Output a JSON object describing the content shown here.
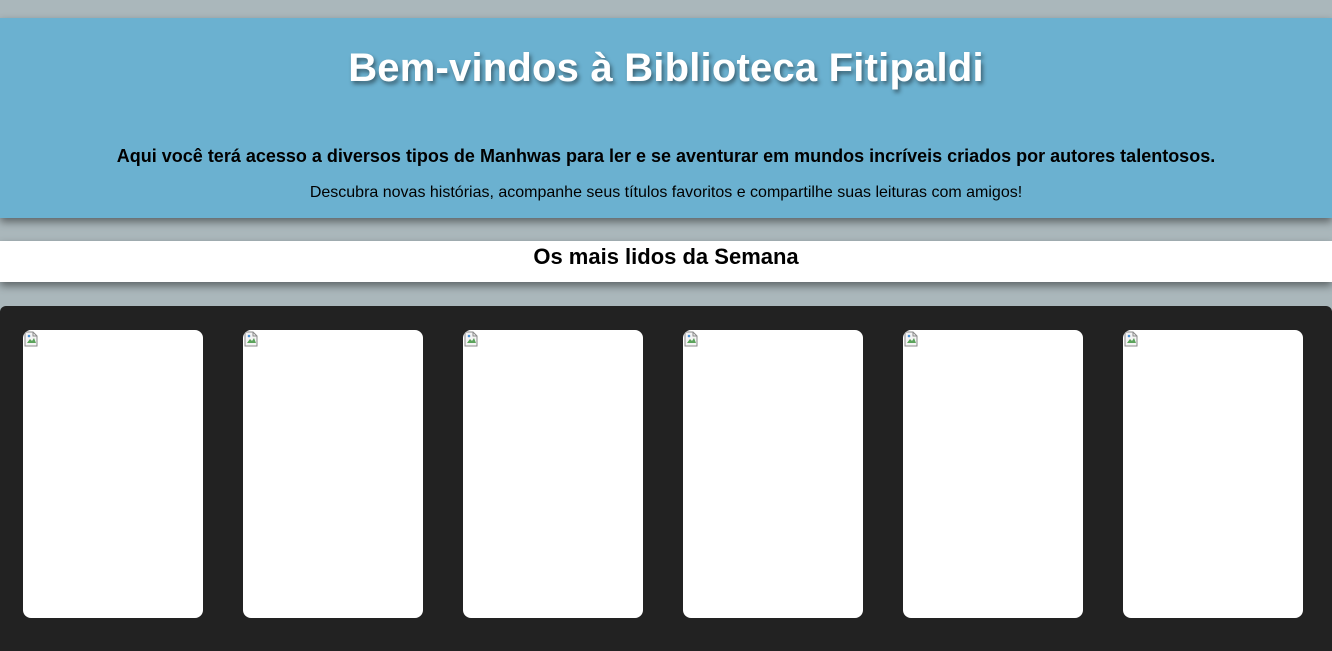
{
  "header": {
    "title": "Bem-vindos à Biblioteca Fitipaldi",
    "lead": "Aqui você terá acesso a diversos tipos de Manhwas para ler e se aventurar em mundos incríveis criados por autores talentosos.",
    "sub": "Descubra novas histórias, acompanhe seus títulos favoritos e compartilhe suas leituras com amigos!"
  },
  "weekly": {
    "heading": "Os mais lidos da Semana"
  },
  "gallery": {
    "cards": [
      {
        "icon": "broken-image-icon"
      },
      {
        "icon": "broken-image-icon"
      },
      {
        "icon": "broken-image-icon"
      },
      {
        "icon": "broken-image-icon"
      },
      {
        "icon": "broken-image-icon"
      },
      {
        "icon": "broken-image-icon"
      }
    ]
  },
  "colors": {
    "page_background": "#aab7bb",
    "header_background": "#6bb1d0",
    "gallery_background": "#222222",
    "card_background": "#ffffff"
  }
}
